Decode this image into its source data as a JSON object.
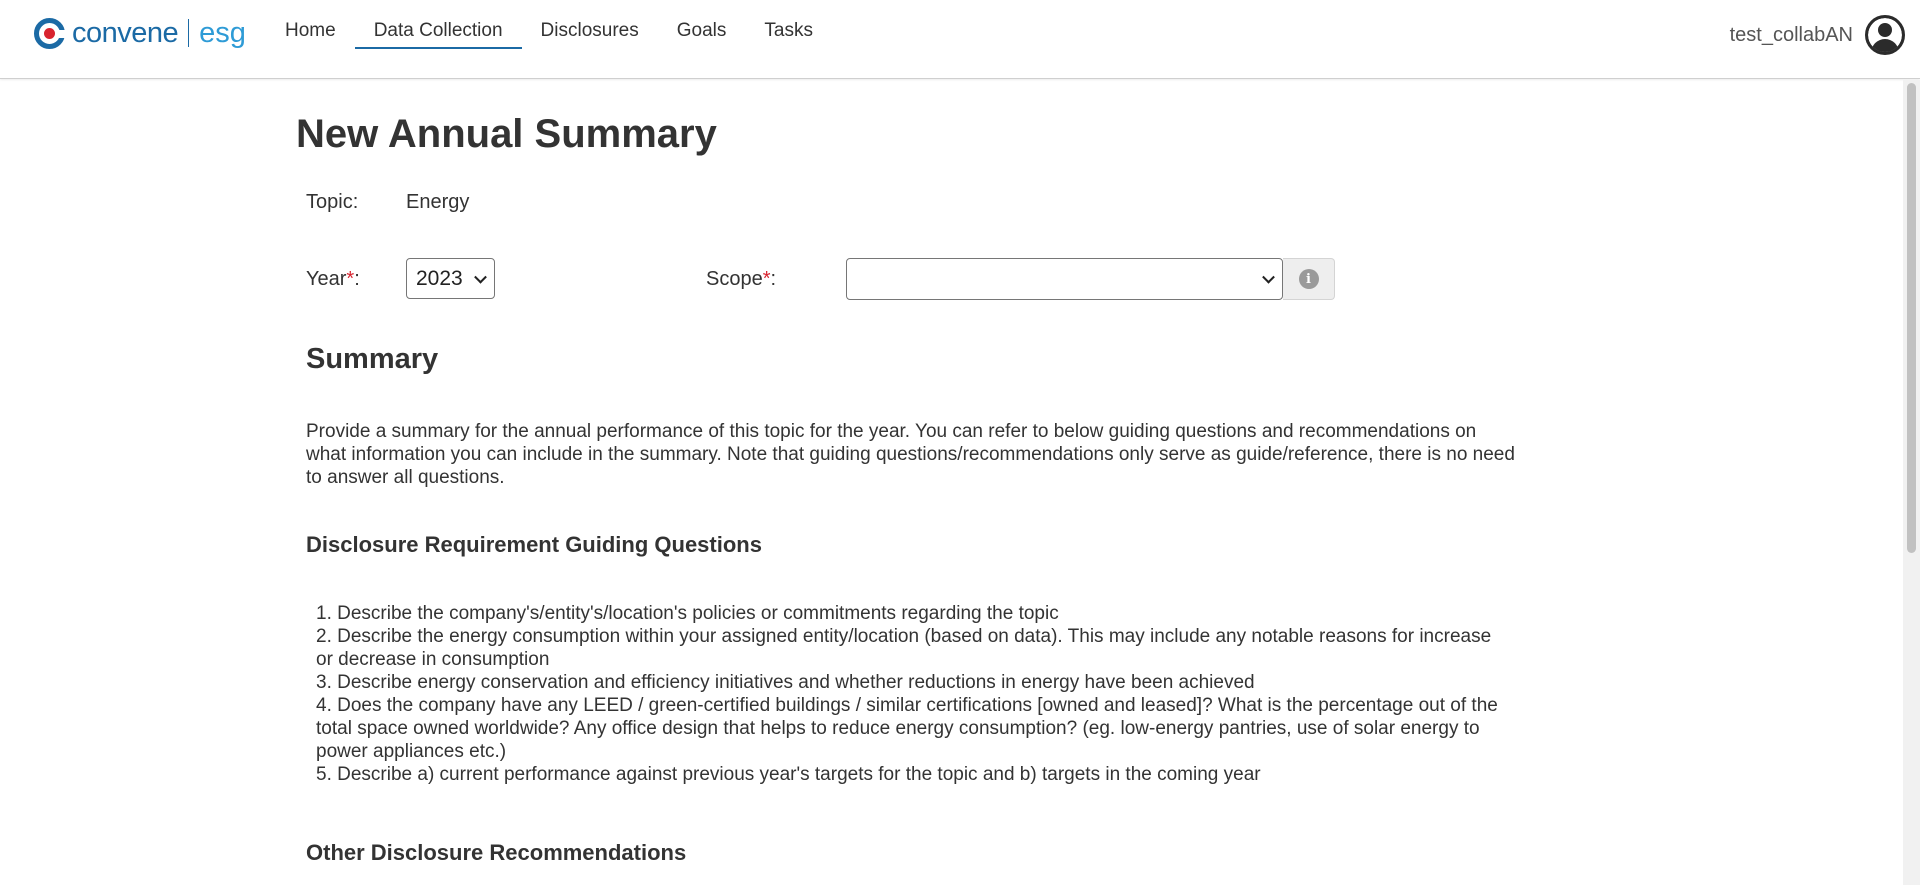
{
  "brand": {
    "name": "convene",
    "sub": "esg"
  },
  "nav": {
    "items": [
      {
        "label": "Home"
      },
      {
        "label": "Data Collection"
      },
      {
        "label": "Disclosures"
      },
      {
        "label": "Goals"
      },
      {
        "label": "Tasks"
      }
    ],
    "active": "Data Collection"
  },
  "user": {
    "name": "test_collabAN"
  },
  "page": {
    "title": "New Annual Summary",
    "topic_label": "Topic:",
    "topic_value": "Energy",
    "year_label": "Year",
    "year_value": "2023",
    "scope_label": "Scope",
    "scope_value": "",
    "required_mark": "*",
    "colon": ":"
  },
  "summary": {
    "title": "Summary",
    "intro": "Provide a summary for the annual performance of this topic for the year. You can refer to below guiding questions and recommendations on what information you can include in the summary. Note that guiding questions/recommendations only serve as guide/reference, there is no need to answer all questions."
  },
  "guiding": {
    "title": "Disclosure Requirement Guiding Questions",
    "questions": [
      "1. Describe the company's/entity's/location's policies or commitments regarding the topic",
      "2. Describe the energy consumption within your assigned entity/location (based on data). This may include any notable reasons for increase or decrease in consumption",
      "3. Describe energy conservation and efficiency initiatives and whether reductions in energy have been achieved",
      "4. Does the company have any LEED / green-certified buildings / similar certifications [owned and leased]? What is the percentage out of the total space owned worldwide? Any office design that helps to reduce energy consumption? (eg. low-energy pantries, use of solar energy to power appliances etc.)",
      "5. Describe a) current performance against previous year's targets for the topic and b) targets in the coming year"
    ]
  },
  "other": {
    "title": "Other Disclosure Recommendations"
  },
  "colors": {
    "brand": "#1b6aa5",
    "brand_light": "#2e9bd6",
    "required": "#d8232f"
  },
  "icons": {
    "brand": "convene-logo-icon",
    "avatar": "user-avatar-icon",
    "info": "info-icon",
    "dropdown": "chevron-down-icon"
  }
}
